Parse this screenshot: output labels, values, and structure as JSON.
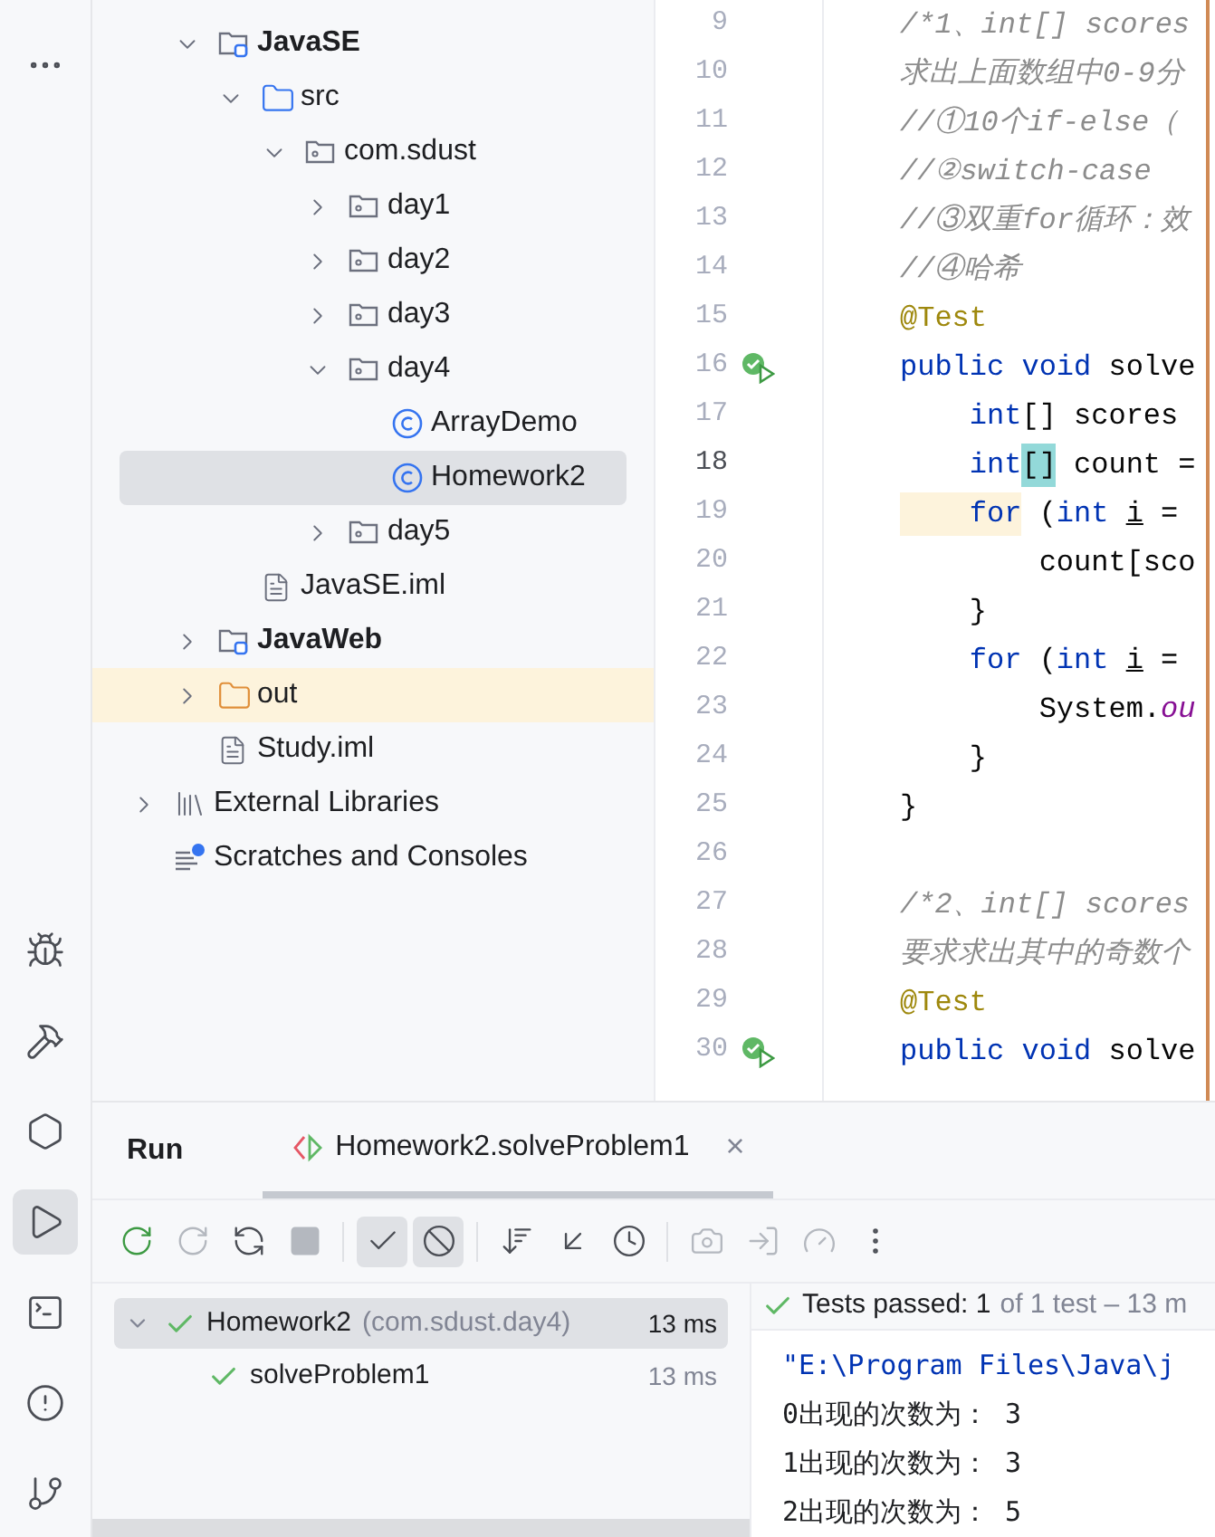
{
  "tool_strip": {
    "items": [
      {
        "kind": "more",
        "selected": false
      },
      {
        "kind": "debug",
        "selected": false
      },
      {
        "kind": "build",
        "selected": false
      },
      {
        "kind": "services",
        "selected": false
      },
      {
        "kind": "run",
        "selected": true
      },
      {
        "kind": "terminal",
        "selected": false
      },
      {
        "kind": "problems",
        "selected": false
      },
      {
        "kind": "git",
        "selected": false
      }
    ]
  },
  "project_tree": {
    "project_children": [
      {
        "label": "JavaSE",
        "kind": "module",
        "expanded": true,
        "selected": false,
        "children": [
          {
            "label": "src",
            "kind": "source-folder",
            "expanded": true,
            "selected": false,
            "children": [
              {
                "label": "com.sdust",
                "kind": "package",
                "expanded": true,
                "selected": false,
                "children": [
                  {
                    "label": "day1",
                    "kind": "package",
                    "expanded": false,
                    "selected": false
                  },
                  {
                    "label": "day2",
                    "kind": "package",
                    "expanded": false,
                    "selected": false
                  },
                  {
                    "label": "day3",
                    "kind": "package",
                    "expanded": false,
                    "selected": false
                  },
                  {
                    "label": "day4",
                    "kind": "package",
                    "expanded": true,
                    "selected": false,
                    "children": [
                      {
                        "label": "ArrayDemo",
                        "kind": "class",
                        "selected": false
                      },
                      {
                        "label": "Homework2",
                        "kind": "class",
                        "selected": true
                      }
                    ]
                  },
                  {
                    "label": "day5",
                    "kind": "package",
                    "expanded": false,
                    "selected": false
                  }
                ]
              }
            ]
          },
          {
            "label": "JavaSE.iml",
            "kind": "file",
            "selected": false
          }
        ]
      },
      {
        "label": "JavaWeb",
        "kind": "module",
        "expanded": false,
        "selected": false
      },
      {
        "label": "out",
        "kind": "excluded-folder",
        "expanded": false,
        "selected": false,
        "excluded": true
      },
      {
        "label": "Study.iml",
        "kind": "file",
        "selected": false
      }
    ],
    "roots": [
      {
        "label": "External Libraries",
        "kind": "libraries",
        "expanded": false,
        "selected": false
      },
      {
        "label": "Scratches and Consoles",
        "kind": "scratches",
        "selected": false
      }
    ]
  },
  "editor": {
    "lines": [
      {
        "number": "9",
        "current": false,
        "run_marker": false,
        "tokens": [
          {
            "kind": "comment",
            "text": "/*1、int[] scores"
          }
        ]
      },
      {
        "number": "10",
        "current": false,
        "run_marker": false,
        "tokens": [
          {
            "kind": "comment",
            "text": "求出上面数组中0-9分"
          }
        ]
      },
      {
        "number": "11",
        "current": false,
        "run_marker": false,
        "tokens": [
          {
            "kind": "comment",
            "text": "//①10个if-else（"
          }
        ]
      },
      {
        "number": "12",
        "current": false,
        "run_marker": false,
        "tokens": [
          {
            "kind": "comment",
            "text": "//②switch-case"
          }
        ]
      },
      {
        "number": "13",
        "current": false,
        "run_marker": false,
        "tokens": [
          {
            "kind": "comment",
            "text": "//③双重for循环：效"
          }
        ]
      },
      {
        "number": "14",
        "current": false,
        "run_marker": false,
        "tokens": [
          {
            "kind": "comment",
            "text": "//④哈希"
          }
        ]
      },
      {
        "number": "15",
        "current": false,
        "run_marker": false,
        "tokens": [
          {
            "kind": "annotation",
            "text": "@Test"
          }
        ]
      },
      {
        "number": "16",
        "current": false,
        "run_marker": true,
        "tokens": [
          {
            "kind": "keyword",
            "text": "public void "
          },
          {
            "kind": "plain",
            "text": "solve"
          }
        ]
      },
      {
        "number": "17",
        "current": false,
        "run_marker": false,
        "tokens": [
          {
            "kind": "keyword",
            "text": "    int"
          },
          {
            "kind": "plain",
            "text": "[] scores"
          }
        ]
      },
      {
        "number": "18",
        "current": true,
        "run_marker": false,
        "tokens": [
          {
            "kind": "keyword",
            "text": "    int"
          },
          {
            "kind": "matched",
            "text": "[]"
          },
          {
            "kind": "plain",
            "text": " count ="
          }
        ]
      },
      {
        "number": "19",
        "current": false,
        "run_marker": false,
        "tokens": [
          {
            "kind": "keyword-caret",
            "text": "    for"
          },
          {
            "kind": "plain",
            "text": " ("
          },
          {
            "kind": "keyword",
            "text": "int "
          },
          {
            "kind": "variable",
            "text": "i"
          },
          {
            "kind": "plain",
            "text": " ="
          }
        ]
      },
      {
        "number": "20",
        "current": false,
        "run_marker": false,
        "tokens": [
          {
            "kind": "plain",
            "text": "        count[sco"
          }
        ]
      },
      {
        "number": "21",
        "current": false,
        "run_marker": false,
        "tokens": [
          {
            "kind": "plain",
            "text": "    }"
          }
        ]
      },
      {
        "number": "22",
        "current": false,
        "run_marker": false,
        "tokens": [
          {
            "kind": "keyword",
            "text": "    for"
          },
          {
            "kind": "plain",
            "text": " ("
          },
          {
            "kind": "keyword",
            "text": "int "
          },
          {
            "kind": "variable",
            "text": "i"
          },
          {
            "kind": "plain",
            "text": " ="
          }
        ]
      },
      {
        "number": "23",
        "current": false,
        "run_marker": false,
        "tokens": [
          {
            "kind": "plain",
            "text": "        System."
          },
          {
            "kind": "field",
            "text": "ou"
          }
        ]
      },
      {
        "number": "24",
        "current": false,
        "run_marker": false,
        "tokens": [
          {
            "kind": "plain",
            "text": "    }"
          }
        ]
      },
      {
        "number": "25",
        "current": false,
        "run_marker": false,
        "tokens": [
          {
            "kind": "plain",
            "text": "}"
          }
        ]
      },
      {
        "number": "26",
        "current": false,
        "run_marker": false
      },
      {
        "number": "27",
        "current": false,
        "run_marker": false,
        "tokens": [
          {
            "kind": "comment",
            "text": "/*2、int[] scores"
          }
        ]
      },
      {
        "number": "28",
        "current": false,
        "run_marker": false,
        "tokens": [
          {
            "kind": "comment",
            "text": "要求求出其中的奇数个"
          }
        ]
      },
      {
        "number": "29",
        "current": false,
        "run_marker": false,
        "tokens": [
          {
            "kind": "annotation",
            "text": "@Test"
          }
        ]
      },
      {
        "number": "30",
        "current": false,
        "run_marker": true,
        "tokens": [
          {
            "kind": "keyword",
            "text": "public void "
          },
          {
            "kind": "plain",
            "text": "solve"
          }
        ]
      }
    ]
  },
  "run_panel": {
    "title": "Run",
    "tab": {
      "label": "Homework2.solveProblem1",
      "close": "×",
      "selected": true
    },
    "toolbar": [
      {
        "kind": "rerun",
        "disabled": false,
        "selected": false
      },
      {
        "kind": "rerun-failed",
        "disabled": true,
        "selected": false
      },
      {
        "kind": "toggle-auto",
        "disabled": false,
        "selected": false
      },
      {
        "kind": "stop",
        "disabled": true,
        "selected": false
      },
      {
        "kind": "sep"
      },
      {
        "kind": "show-passed",
        "disabled": false,
        "selected": true
      },
      {
        "kind": "show-ignored",
        "disabled": false,
        "selected": true
      },
      {
        "kind": "sep"
      },
      {
        "kind": "sort",
        "disabled": false,
        "selected": false
      },
      {
        "kind": "collapse",
        "disabled": false,
        "selected": false
      },
      {
        "kind": "history",
        "disabled": false,
        "selected": false
      },
      {
        "kind": "sep"
      },
      {
        "kind": "snapshot",
        "disabled": true,
        "selected": false
      },
      {
        "kind": "export",
        "disabled": true,
        "selected": false
      },
      {
        "kind": "coverage",
        "disabled": true,
        "selected": false
      },
      {
        "kind": "more",
        "disabled": false,
        "selected": false
      }
    ],
    "tests": [
      {
        "name": "Homework2",
        "package": "(com.sdust.day4)",
        "time": "13 ms",
        "expanded": true,
        "selected": true,
        "children": [
          {
            "name": "solveProblem1",
            "time": "13 ms",
            "selected": false
          }
        ]
      }
    ],
    "status": {
      "passed": "Tests passed: 1",
      "detail": "of 1 test – 13 m"
    },
    "console": [
      "\"E:\\Program Files\\Java\\j",
      "0出现的次数为： 3",
      "1出现的次数为： 3",
      "2出现的次数为： 5"
    ]
  }
}
